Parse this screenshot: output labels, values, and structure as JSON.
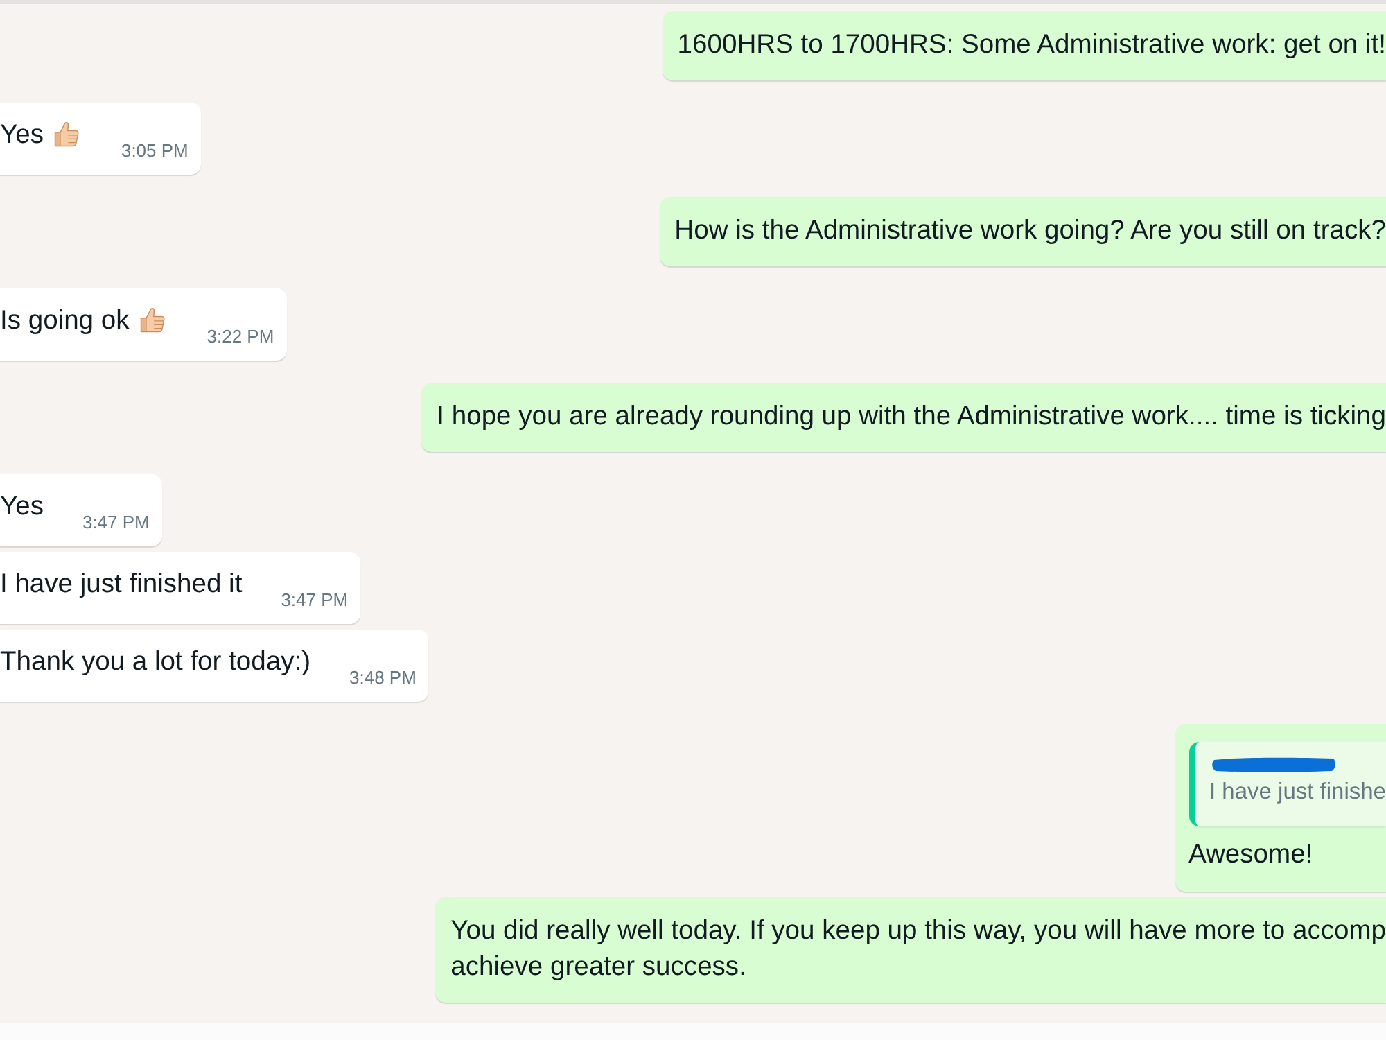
{
  "messages": [
    {
      "outgoing": true,
      "text": "1600HRS to 1700HRS: Some Administrative work: get on it!"
    },
    {
      "outgoing": false,
      "text": "Yes",
      "emoji": true,
      "time": "3:05 PM"
    },
    {
      "outgoing": true,
      "text": "How is the Administrative work going? Are you still on track?"
    },
    {
      "outgoing": false,
      "text": "Is going ok",
      "emoji": true,
      "time": "3:22 PM"
    },
    {
      "outgoing": true,
      "text": "I hope you are already rounding up with the Administrative work.... time is ticking"
    },
    {
      "outgoing": false,
      "text": "Yes",
      "emoji": false,
      "time": "3:47 PM"
    },
    {
      "outgoing": false,
      "text": "I have just finished it",
      "emoji": false,
      "time": "3:47 PM"
    },
    {
      "outgoing": false,
      "text": "Thank you a lot for today:)",
      "emoji": false,
      "time": "3:48 PM"
    },
    {
      "outgoing": true,
      "quote": {
        "author_redacted": true,
        "text": "I have just finishe"
      },
      "text": "Awesome!"
    },
    {
      "outgoing": true,
      "lines": [
        "You did really well today. If you keep up this way, you will have more to accomp",
        "achieve greater success."
      ]
    }
  ]
}
